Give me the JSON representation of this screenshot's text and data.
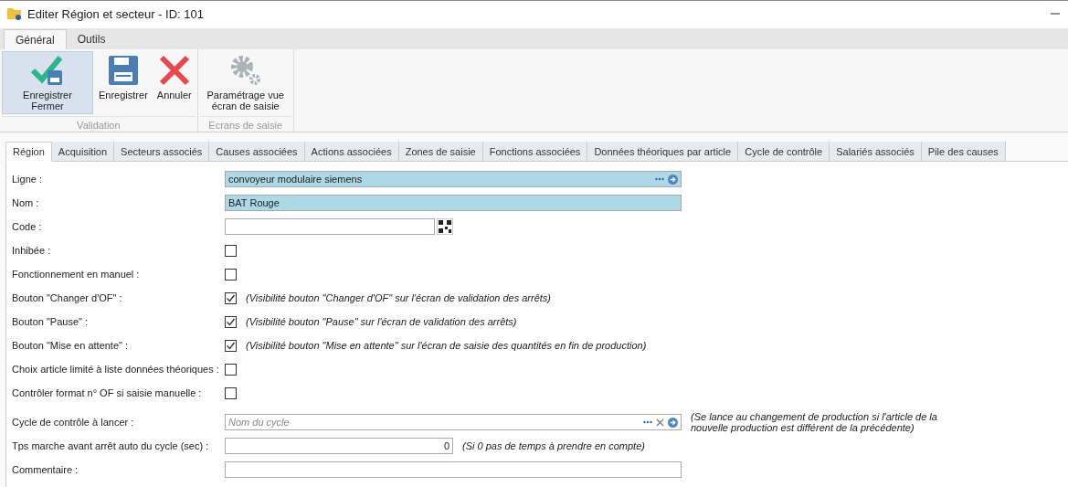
{
  "window": {
    "title": "Editer Région et secteur - ID: 101"
  },
  "ribbon_tabs": [
    {
      "label": "Général",
      "selected": true
    },
    {
      "label": "Outils",
      "selected": false
    }
  ],
  "ribbon_groups": [
    {
      "label": "Validation",
      "buttons": [
        {
          "kind": "save-close",
          "label": "Enregistrer Fermer",
          "selected": true
        },
        {
          "kind": "save",
          "label": "Enregistrer",
          "selected": false
        },
        {
          "kind": "cancel",
          "label": "Annuler",
          "selected": false
        }
      ]
    },
    {
      "label": "Ecrans de saisie",
      "buttons": [
        {
          "kind": "settings",
          "label": "Paramétrage vue écran de saisie",
          "selected": false
        }
      ]
    }
  ],
  "tabs": [
    {
      "label": "Région",
      "selected": true
    },
    {
      "label": "Acquisition",
      "selected": false
    },
    {
      "label": "Secteurs associés",
      "selected": false
    },
    {
      "label": "Causes associées",
      "selected": false
    },
    {
      "label": "Actions associées",
      "selected": false
    },
    {
      "label": "Zones de saisie",
      "selected": false
    },
    {
      "label": "Fonctions associées",
      "selected": false
    },
    {
      "label": "Données théoriques par article",
      "selected": false
    },
    {
      "label": "Cycle de contrôle",
      "selected": false
    },
    {
      "label": "Salariés associés",
      "selected": false
    },
    {
      "label": "Pile des causes",
      "selected": false
    }
  ],
  "form": [
    {
      "kind": "lookup",
      "label": "Ligne :",
      "value": "convoyeur modulaire siemens",
      "highlighted": true
    },
    {
      "kind": "text",
      "label": "Nom :",
      "value": "BAT Rouge",
      "highlighted": true
    },
    {
      "kind": "code",
      "label": "Code :"
    },
    {
      "kind": "checkbox",
      "label": "Inhibée :",
      "checked": false
    },
    {
      "kind": "checkbox",
      "label": "Fonctionnement en manuel :",
      "checked": false
    },
    {
      "kind": "checkbox",
      "label": "Bouton \"Changer d'OF\" :",
      "checked": true,
      "note": "(Visibilité bouton \"Changer d'OF\" sur l'écran de validation des arrêts)"
    },
    {
      "kind": "checkbox",
      "label": "Bouton \"Pause\" :",
      "checked": true,
      "note": "(Visibilité bouton \"Pause\" sur l'écran de validation des arrêts)"
    },
    {
      "kind": "checkbox",
      "label": "Bouton \"Mise en attente\" :",
      "checked": true,
      "note": "(Visibilité bouton \"Mise en attente\" sur l'écran de saisie des quantités en fin de production)"
    },
    {
      "kind": "checkbox",
      "label": "Choix article limité à liste données théoriques :",
      "checked": false
    },
    {
      "kind": "checkbox",
      "label": "Contrôler format n° OF si saisie manuelle :",
      "checked": false
    },
    {
      "kind": "lookup-clear",
      "label": "Cycle de contrôle à lancer :",
      "placeholder": "Nom du cycle",
      "highlighted": false,
      "note": "(Se lance au changement de production si l'article de la nouvelle production est différent de la précédente)"
    },
    {
      "kind": "number",
      "label": "Tps marche avant arrêt auto du cycle (sec) :",
      "value": "0",
      "note": "(Si 0 pas de temps à prendre en compte)"
    },
    {
      "kind": "text",
      "label": "Commentaire :",
      "highlighted": false
    }
  ]
}
